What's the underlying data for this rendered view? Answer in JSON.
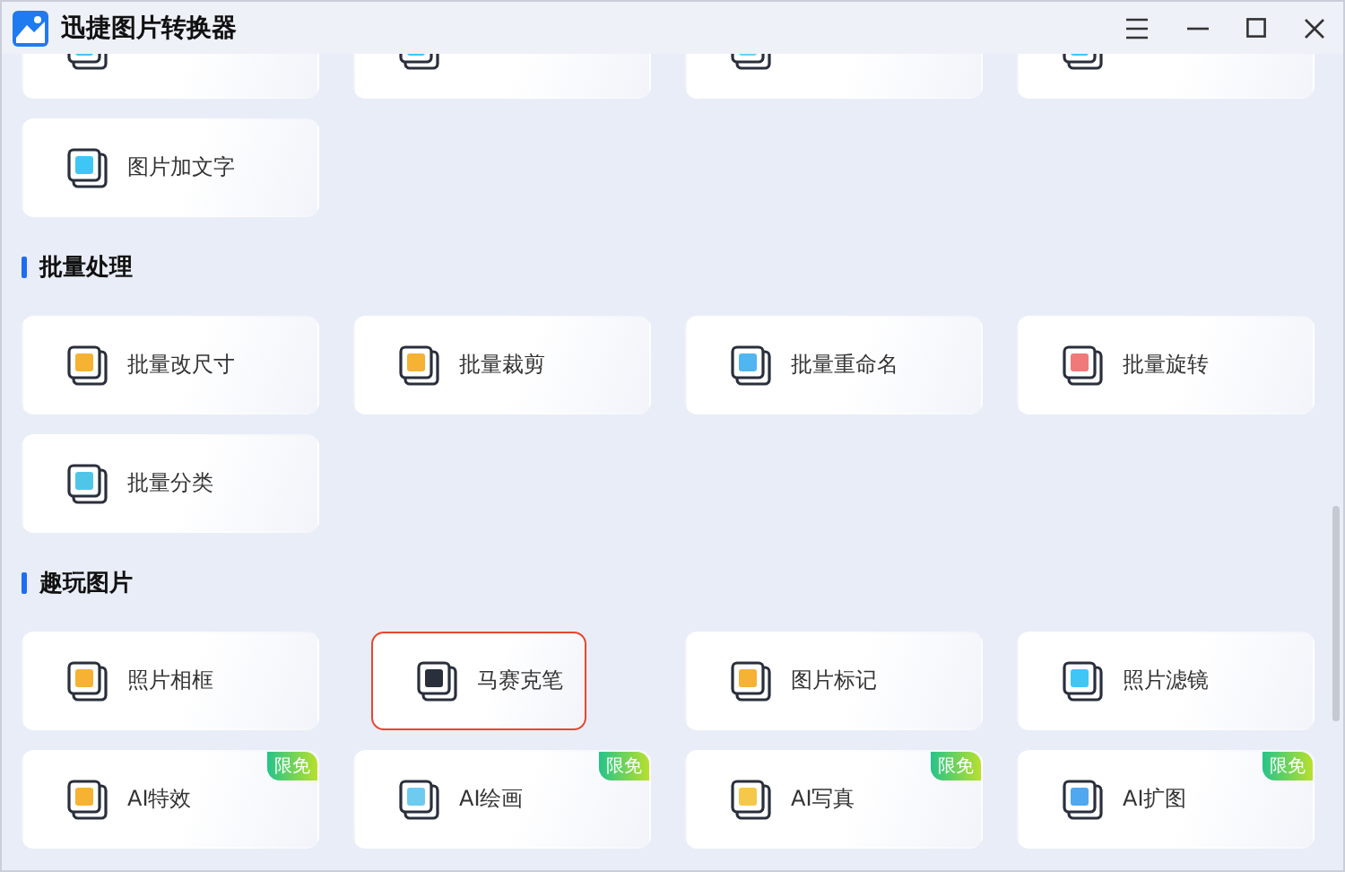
{
  "window": {
    "title": "迅捷图片转换器"
  },
  "sections": [
    {
      "items": [
        {
          "selected": false
        },
        {
          "selected": false
        },
        {
          "selected": false
        },
        {
          "selected": false
        },
        {
          "label": "图片加文字",
          "selected": false
        }
      ]
    },
    {
      "heading": "批量处理",
      "items": [
        {
          "label": "批量改尺寸",
          "selected": false
        },
        {
          "label": "批量裁剪",
          "selected": false
        },
        {
          "label": "批量重命名",
          "selected": false
        },
        {
          "label": "批量旋转",
          "selected": false
        },
        {
          "label": "批量分类",
          "selected": false
        }
      ]
    },
    {
      "heading": "趣玩图片",
      "items": [
        {
          "label": "照片相框",
          "selected": false
        },
        {
          "label": "马赛克笔",
          "selected": true
        },
        {
          "label": "图片标记",
          "selected": false
        },
        {
          "label": "照片滤镜",
          "selected": false
        },
        {
          "label": "AI特效",
          "selected": false,
          "badge": "限免"
        },
        {
          "label": "AI绘画",
          "selected": false,
          "badge": "限免"
        },
        {
          "label": "AI写真",
          "selected": false,
          "badge": "限免"
        },
        {
          "label": "AI扩图",
          "selected": false,
          "badge": "限免"
        }
      ]
    }
  ]
}
